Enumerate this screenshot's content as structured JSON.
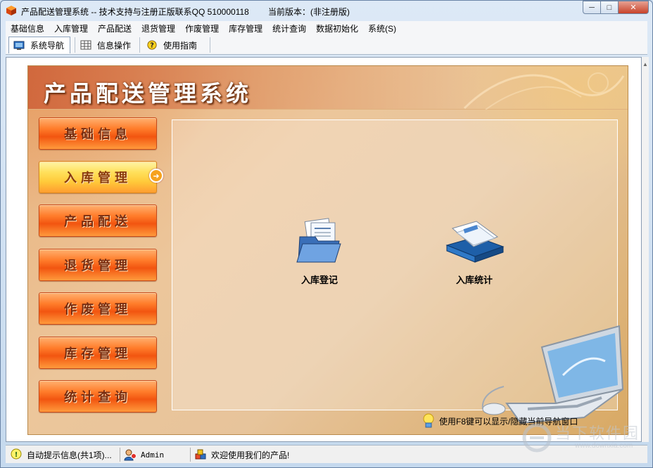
{
  "window": {
    "title": "产品配送管理系统 -- 技术支持与注册正版联系QQ 510000118",
    "version": "当前版本：(非注册版)",
    "minimize": "─",
    "maximize": "□",
    "close": "✕"
  },
  "menu": [
    {
      "label": "基础信息"
    },
    {
      "label": "入库管理"
    },
    {
      "label": "产品配送"
    },
    {
      "label": "退货管理"
    },
    {
      "label": "作废管理"
    },
    {
      "label": "库存管理"
    },
    {
      "label": "统计查询"
    },
    {
      "label": "数据初始化"
    },
    {
      "label": "系统(S)"
    }
  ],
  "tabs": [
    {
      "label": "系统导航",
      "icon": "monitor-icon",
      "active": true
    },
    {
      "label": "信息操作",
      "icon": "grid-icon",
      "active": false
    },
    {
      "label": "使用指南",
      "icon": "help-icon",
      "active": false
    }
  ],
  "panel": {
    "title": "产品配送管理系统",
    "nav": [
      {
        "label": "基础信息"
      },
      {
        "label": "入库管理"
      },
      {
        "label": "产品配送"
      },
      {
        "label": "退货管理"
      },
      {
        "label": "作废管理"
      },
      {
        "label": "库存管理"
      },
      {
        "label": "统计查询"
      }
    ],
    "active_nav_index": 1,
    "functions": [
      {
        "label": "入库登记",
        "icon": "folder-documents-icon"
      },
      {
        "label": "入库统计",
        "icon": "book-icon"
      }
    ],
    "hint": "使用F8键可以显示/隐藏当前导航窗口"
  },
  "status": {
    "tips": "自动提示信息(共1项)...",
    "user": "Admin",
    "welcome": "欢迎使用我们的产品!"
  },
  "watermark": {
    "text": "当下软件园",
    "url": "www.downxia.com"
  },
  "colors": {
    "nav_button": "#ff7c2a",
    "nav_button_active": "#ffe05a",
    "panel_background": "#ecc69b"
  }
}
